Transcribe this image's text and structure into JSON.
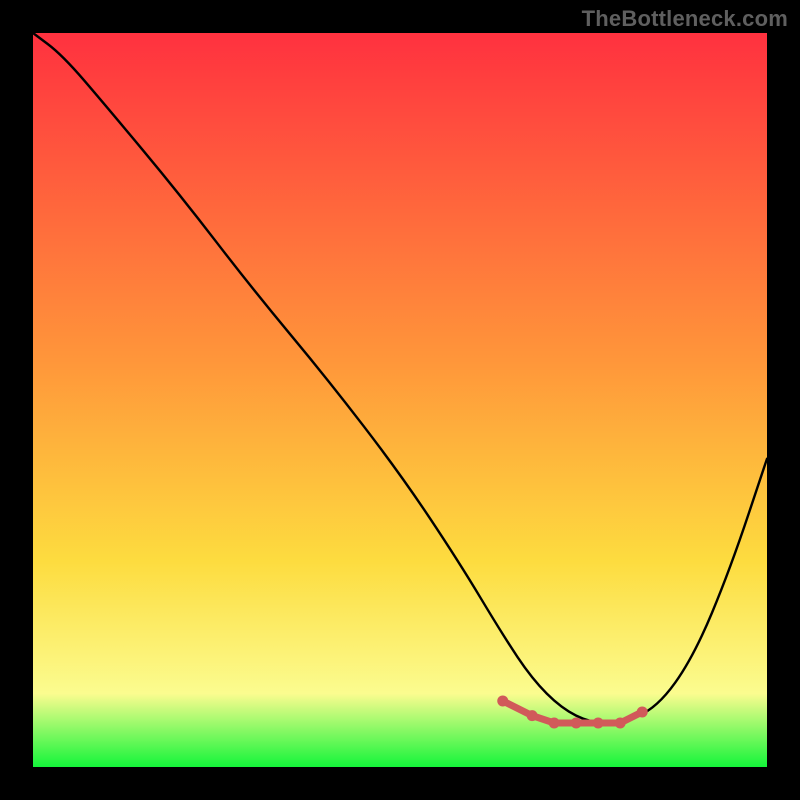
{
  "watermark": "TheBottleneck.com",
  "colors": {
    "background": "#000000",
    "curve": "#000000",
    "marker": "#d15a5a",
    "gradient_green": "#14f53a",
    "gradient_yellow_light": "#fbfc8f",
    "gradient_yellow": "#fddc3f",
    "gradient_orange": "#ff973a",
    "gradient_red": "#ff313f"
  },
  "chart_data": {
    "type": "line",
    "title": "",
    "xlabel": "",
    "ylabel": "",
    "xlim": [
      0,
      100
    ],
    "ylim": [
      0,
      100
    ],
    "legend": false,
    "grid": false,
    "series": [
      {
        "name": "bottleneck-curve",
        "x": [
          0,
          4,
          10,
          20,
          30,
          40,
          50,
          58,
          64,
          68,
          72,
          76,
          80,
          85,
          90,
          95,
          100
        ],
        "y": [
          100,
          97,
          90,
          78,
          65,
          53,
          40,
          28,
          18,
          12,
          8,
          6,
          6,
          8,
          15,
          27,
          42
        ]
      }
    ],
    "markers": {
      "name": "optimal-range",
      "x": [
        64,
        68,
        71,
        74,
        77,
        80,
        83
      ],
      "y": [
        9,
        7,
        6,
        6,
        6,
        6,
        7.5
      ]
    },
    "annotations": []
  }
}
